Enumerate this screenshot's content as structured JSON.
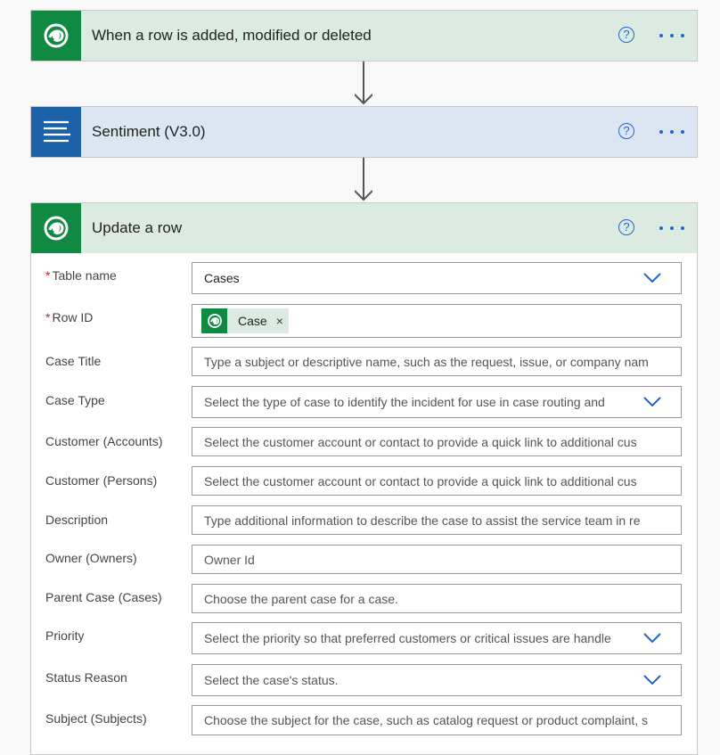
{
  "colors": {
    "dataverse_green": "#108a43",
    "header_green_bg": "#dcebe2",
    "text_analytics_blue": "#1b62a9",
    "header_blue_bg": "#dbe6f2",
    "accent_blue": "#2266cc",
    "required_red": "#c4262e"
  },
  "trigger": {
    "icon": "dataverse-icon",
    "title": "When a row is added, modified or deleted",
    "help_icon": "help-icon",
    "more_icon": "more-options-icon"
  },
  "sentiment": {
    "icon": "text-lines-icon",
    "title": "Sentiment (V3.0)",
    "help_icon": "help-icon",
    "more_icon": "more-options-icon"
  },
  "update_row": {
    "icon": "dataverse-icon",
    "title": "Update a row",
    "help_icon": "help-icon",
    "more_icon": "more-options-icon",
    "fields": [
      {
        "label": "Table name",
        "required": "*",
        "value": "Cases",
        "type": "dropdown"
      },
      {
        "label": "Row ID",
        "required": "*",
        "token": {
          "label": "Case",
          "close": "×"
        },
        "type": "token"
      },
      {
        "label": "Case Title",
        "placeholder": "Type a subject or descriptive name, such as the request, issue, or company nam",
        "type": "text"
      },
      {
        "label": "Case Type",
        "placeholder": "Select the type of case to identify the incident for use in case routing and",
        "type": "dropdown"
      },
      {
        "label": "Customer (Accounts)",
        "placeholder": "Select the customer account or contact to provide a quick link to additional cus",
        "type": "text"
      },
      {
        "label": "Customer (Persons)",
        "placeholder": "Select the customer account or contact to provide a quick link to additional cus",
        "type": "text"
      },
      {
        "label": "Description",
        "placeholder": "Type additional information to describe the case to assist the service team in re",
        "type": "text"
      },
      {
        "label": "Owner (Owners)",
        "placeholder": "Owner Id",
        "type": "text"
      },
      {
        "label": "Parent Case (Cases)",
        "placeholder": "Choose the parent case for a case.",
        "type": "text"
      },
      {
        "label": "Priority",
        "placeholder": "Select the priority so that preferred customers or critical issues are handle",
        "type": "dropdown"
      },
      {
        "label": "Status Reason",
        "placeholder": "Select the case's status.",
        "type": "dropdown"
      },
      {
        "label": "Subject (Subjects)",
        "placeholder": "Choose the subject for the case, such as catalog request or product complaint, s",
        "type": "text"
      }
    ]
  }
}
